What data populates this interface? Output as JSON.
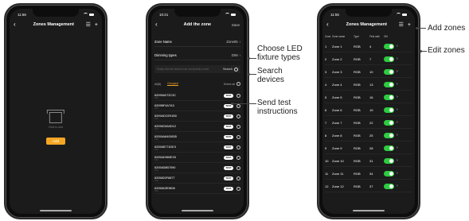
{
  "phone1": {
    "time": "11:56",
    "title": "Zones Management",
    "filter_icon": "filter-list-icon",
    "add_icon": "plus-icon",
    "empty_text": "Click to add",
    "add_button": "Add"
  },
  "phone2": {
    "time": "10:21",
    "title": "Add the zone",
    "save_label": "Save",
    "zone_name_label": "Zone Name",
    "zone_name_value": "Zone05",
    "dimming_label": "Dimming types",
    "dimming_value": "DIM",
    "search_placeholder": "Kindly click the search icon and quickly to add",
    "search_label": "Search",
    "tab_all": "All(8)",
    "tab_grouped": "Grouped",
    "select_all": "Select all",
    "test_label": "TEST",
    "devices": [
      {
        "id": "62095A072C3C",
        "sub": "DIM"
      },
      {
        "id": "6209BF4A7A3",
        "sub": "DIM"
      },
      {
        "id": "6209ADCE91B0",
        "sub": "DIM"
      },
      {
        "id": "62096C8A0D12",
        "sub": "DIM"
      },
      {
        "id": "62054A8400835",
        "sub": "DIM"
      },
      {
        "id": "62054B771DE3",
        "sub": "DIM"
      },
      {
        "id": "6205AD960E33",
        "sub": "DIM"
      },
      {
        "id": "62054D8B7090",
        "sub": "DIM"
      },
      {
        "id": "6205820F8877",
        "sub": "DIM"
      },
      {
        "id": "6205843E9606",
        "sub": "DIM"
      }
    ]
  },
  "phone3": {
    "time": "11:55",
    "title": "Zones Management",
    "headers": [
      "Zone",
      "Zone name",
      "Type",
      "First add.",
      "ON"
    ],
    "zones": [
      {
        "no": "1",
        "name": "Zone 1",
        "type": "RGB",
        "addr": "4"
      },
      {
        "no": "2",
        "name": "Zone 2",
        "type": "RGB",
        "addr": "7"
      },
      {
        "no": "3",
        "name": "Zone 3",
        "type": "RGB",
        "addr": "10"
      },
      {
        "no": "4",
        "name": "Zone 4",
        "type": "RGB",
        "addr": "13"
      },
      {
        "no": "5",
        "name": "Zone 5",
        "type": "RGB",
        "addr": "16"
      },
      {
        "no": "6",
        "name": "Zone 6",
        "type": "RGB",
        "addr": "19"
      },
      {
        "no": "7",
        "name": "Zone 7",
        "type": "RGB",
        "addr": "22"
      },
      {
        "no": "8",
        "name": "Zone 8",
        "type": "RGB",
        "addr": "25"
      },
      {
        "no": "9",
        "name": "Zone 9",
        "type": "RGB",
        "addr": "28"
      },
      {
        "no": "10",
        "name": "Zone 10",
        "type": "RGB",
        "addr": "31"
      },
      {
        "no": "11",
        "name": "Zone 11",
        "type": "RGB",
        "addr": "34"
      },
      {
        "no": "12",
        "name": "Zone 12",
        "type": "RGB",
        "addr": "37"
      }
    ]
  },
  "callouts": {
    "choose_led": "Choose LED fixture types",
    "search_devices": "Search devices",
    "send_test": "Send test instructions",
    "add_zones": "Add zones",
    "edit_zones": "Edit zones"
  },
  "colors": {
    "accent": "#f5a623",
    "toggle_on": "#2ecc40",
    "screen_bg": "#1b1b1b"
  }
}
